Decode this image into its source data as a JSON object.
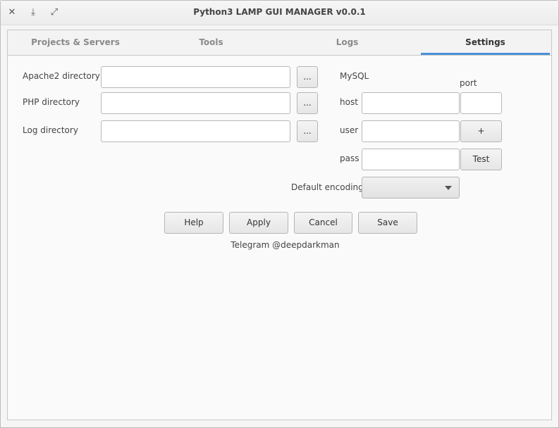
{
  "window": {
    "title": "Python3 LAMP GUI MANAGER v0.0.1",
    "controls": {
      "close": "✕",
      "minimize": "⤓",
      "maximize": "⤢"
    }
  },
  "tabs": [
    {
      "label": "Projects & Servers"
    },
    {
      "label": "Tools"
    },
    {
      "label": "Logs"
    },
    {
      "label": "Settings",
      "active": true
    }
  ],
  "settings": {
    "apache_label": "Apache2 directory",
    "apache_value": "",
    "php_label": "PHP directory",
    "php_value": "",
    "log_label": "Log directory",
    "log_value": "",
    "browse_label": "...",
    "mysql_title": "MySQL",
    "port_label": "port",
    "host_label": "host",
    "host_value": "",
    "port_value": "",
    "user_label": "user",
    "user_value": "",
    "add_label": "+",
    "pass_label": "pass",
    "pass_value": "",
    "test_label": "Test",
    "encoding_label": "Default encoding",
    "encoding_value": ""
  },
  "actions": {
    "help": "Help",
    "apply": "Apply",
    "cancel": "Cancel",
    "save": "Save"
  },
  "footer": {
    "telegram": "Telegram @deepdarkman"
  },
  "colors": {
    "accent": "#4a90d9"
  }
}
